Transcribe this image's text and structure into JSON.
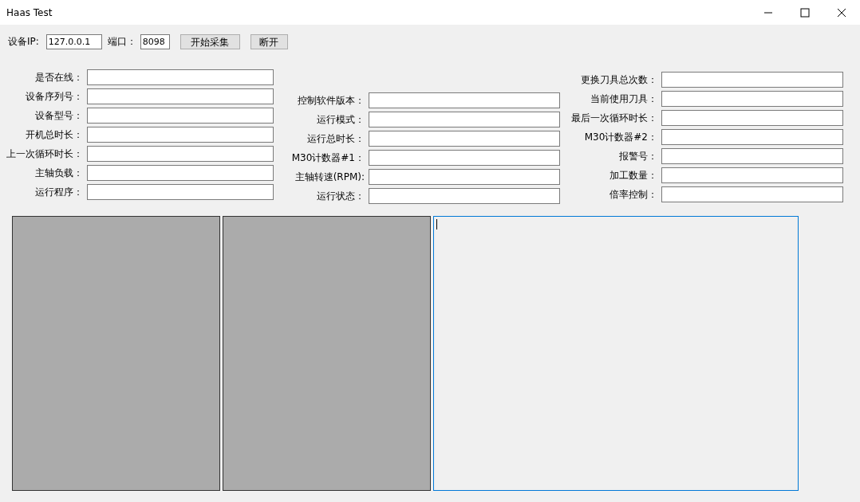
{
  "window": {
    "title": "Haas Test",
    "controls": [
      {
        "kind": "minimize"
      },
      {
        "kind": "maximize"
      },
      {
        "kind": "close"
      }
    ]
  },
  "toolbar": {
    "ip_label": "设备IP:",
    "ip_value": "127.0.0.1",
    "port_label": "端口：",
    "port_value": "8098",
    "buttons": [
      "开始采集",
      "断开"
    ]
  },
  "columns": [
    {
      "fields": [
        {
          "label": "是否在线："
        },
        {
          "label": "设备序列号："
        },
        {
          "label": "设备型号："
        },
        {
          "label": "开机总时长："
        },
        {
          "label": "上一次循环时长："
        },
        {
          "label": "主轴负载："
        },
        {
          "label": "运行程序："
        }
      ]
    },
    {
      "fields": [
        {
          "label": "控制软件版本："
        },
        {
          "label": "运行模式："
        },
        {
          "label": "运行总时长："
        },
        {
          "label": "M30计数器#1："
        },
        {
          "label": "主轴转速(RPM):"
        },
        {
          "label": "运行状态："
        }
      ]
    },
    {
      "fields": [
        {
          "label": "更换刀具总次数："
        },
        {
          "label": "当前使用刀具："
        },
        {
          "label": "最后一次循环时长："
        },
        {
          "label": "M30计数器#2："
        },
        {
          "label": "报警号："
        },
        {
          "label": "加工数量："
        },
        {
          "label": "倍率控制："
        }
      ]
    }
  ],
  "panels": [
    {
      "kind": "image"
    },
    {
      "kind": "image"
    },
    {
      "kind": "log",
      "focused": true
    }
  ]
}
